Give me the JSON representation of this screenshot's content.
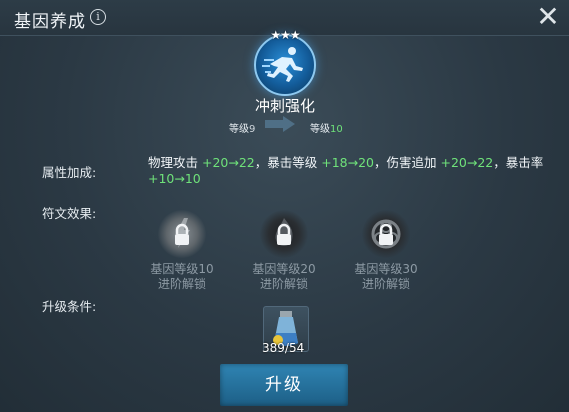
{
  "header": {
    "title": "基因养成",
    "info_icon": "info-icon",
    "close_icon": "close-icon"
  },
  "skill": {
    "name": "冲刺强化",
    "stars": "★★★",
    "icon": "sprinting-figure-icon",
    "level_current_label": "等级",
    "level_current_value": "9",
    "level_next_label": "等级",
    "level_next_value": "10"
  },
  "attributes": {
    "label": "属性加成:",
    "parts": [
      {
        "text": "物理攻击 ",
        "color": "white"
      },
      {
        "text": "+20→22",
        "color": "green"
      },
      {
        "text": "，暴击等级 ",
        "color": "white"
      },
      {
        "text": "+18→20",
        "color": "green"
      },
      {
        "text": "，伤害追加 ",
        "color": "white"
      },
      {
        "text": "+20→22",
        "color": "green"
      },
      {
        "text": "，暴击率",
        "color": "white"
      },
      {
        "text": "+10→10",
        "color": "green"
      }
    ]
  },
  "runes": {
    "label": "符文效果:",
    "items": [
      {
        "line1": "基因等级10",
        "line2": "进阶解锁",
        "icon": "locked-rune-lightning-icon"
      },
      {
        "line1": "基因等级20",
        "line2": "进阶解锁",
        "icon": "locked-rune-flame-icon"
      },
      {
        "line1": "基因等级30",
        "line2": "进阶解锁",
        "icon": "locked-rune-biohazard-icon"
      }
    ]
  },
  "upgrade": {
    "label": "升级条件:",
    "item_icon": "serum-vial-icon",
    "count_have": "389",
    "count_need": "/54",
    "button_label": "升级"
  },
  "colors": {
    "green": "#6fe27a",
    "button": "#2f84b3",
    "background": "#2b3944"
  }
}
